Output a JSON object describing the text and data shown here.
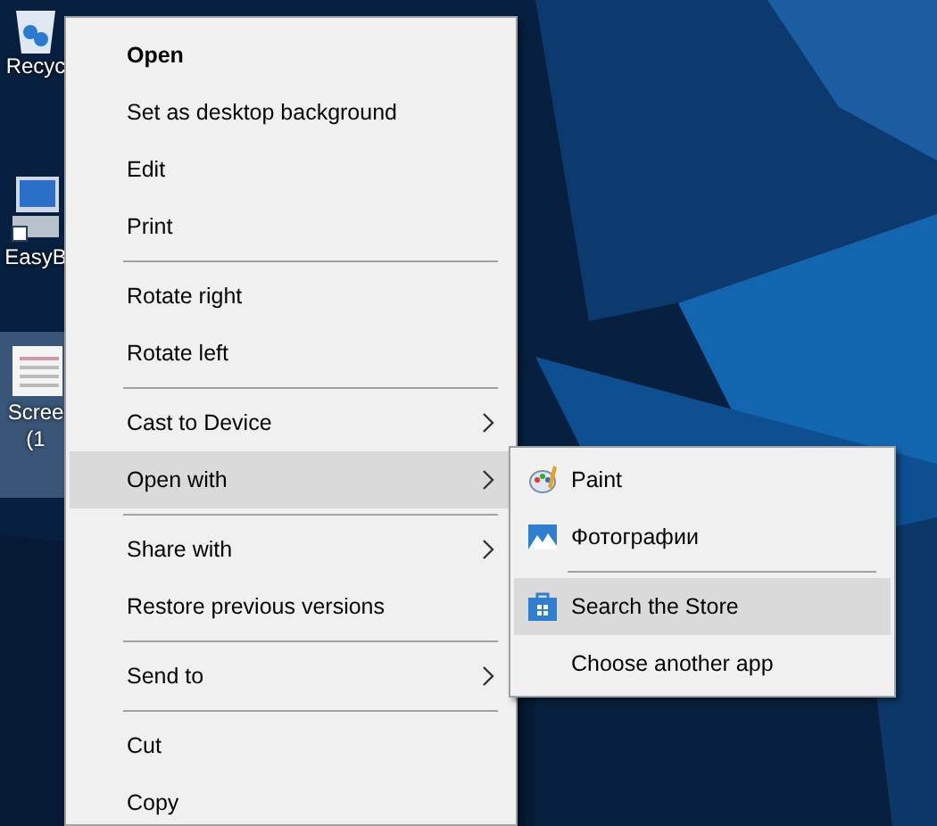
{
  "desktop_icons": [
    {
      "label": "Recyc",
      "kind": "recycle"
    },
    {
      "label": "EasyB",
      "kind": "computer"
    },
    {
      "label": "Scree",
      "label_2": "(1",
      "kind": "document",
      "selected": true
    }
  ],
  "context_menu": {
    "items": [
      {
        "kind": "item",
        "label": "Open",
        "bold": true
      },
      {
        "kind": "item",
        "label": "Set as desktop background"
      },
      {
        "kind": "item",
        "label": "Edit"
      },
      {
        "kind": "item",
        "label": "Print"
      },
      {
        "kind": "separator"
      },
      {
        "kind": "item",
        "label": "Rotate right"
      },
      {
        "kind": "item",
        "label": "Rotate left"
      },
      {
        "kind": "separator"
      },
      {
        "kind": "item",
        "label": "Cast to Device",
        "submenu": true,
        "selected": false
      },
      {
        "kind": "item",
        "label": "Open with",
        "submenu": true,
        "selected": true
      },
      {
        "kind": "separator"
      },
      {
        "kind": "item",
        "label": "Share with",
        "submenu": true,
        "selected": false
      },
      {
        "kind": "item",
        "label": "Restore previous versions"
      },
      {
        "kind": "separator"
      },
      {
        "kind": "item",
        "label": "Send to",
        "submenu": true,
        "selected": false
      },
      {
        "kind": "separator"
      },
      {
        "kind": "item",
        "label": "Cut"
      },
      {
        "kind": "item",
        "label": "Copy"
      }
    ]
  },
  "submenu": {
    "items": [
      {
        "kind": "item",
        "label": "Paint",
        "selected": false
      },
      {
        "kind": "item",
        "label": "Фотографии",
        "selected": false
      },
      {
        "kind": "separator"
      },
      {
        "kind": "item",
        "label": "Search the Store",
        "selected": true
      },
      {
        "kind": "item",
        "label": "Choose another app",
        "selected": false
      }
    ]
  }
}
